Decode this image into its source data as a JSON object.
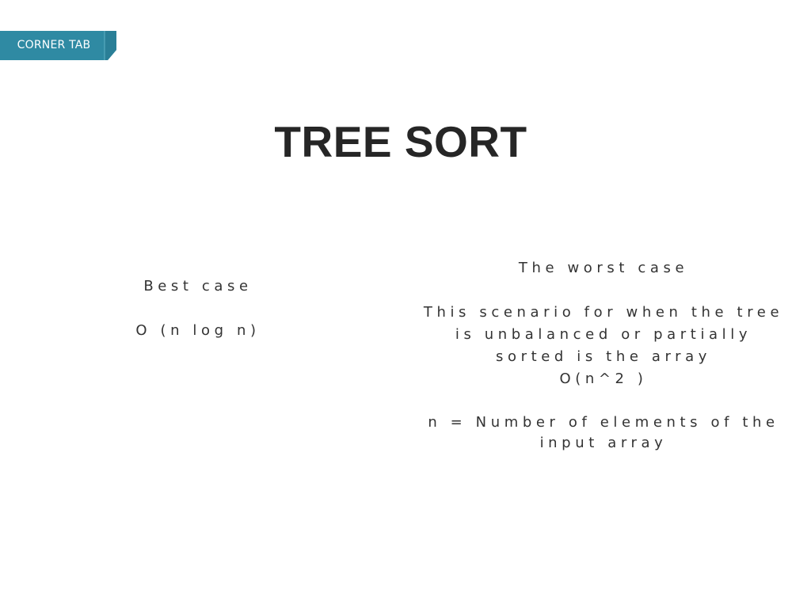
{
  "corner_tab": {
    "label": "CORNER TAB",
    "color": "#2f8aa3",
    "fold_color": "#1f6f86"
  },
  "title": "TREE SORT",
  "best_case": {
    "heading": "Best case",
    "complexity": "O (n log n)"
  },
  "worst_case": {
    "heading": "The worst case",
    "description_lines": [
      "This scenario for when the tree",
      "is unbalanced or partially",
      "sorted is the array"
    ],
    "complexity": "O(n^2 )",
    "note_lines": [
      "n = Number of elements of the",
      "input array"
    ]
  }
}
